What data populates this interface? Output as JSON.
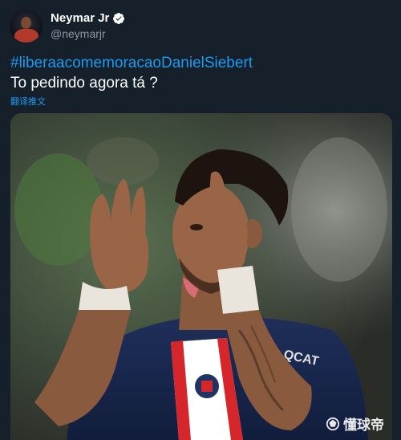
{
  "author": {
    "name": "Neymar Jr",
    "handle": "@neymarjr",
    "verified": true,
    "avatar_icon": "profile-avatar"
  },
  "tweet": {
    "hashtag": "#liberaacomemoracaoDanielSiebert",
    "text": "To pedindo agora tá ?",
    "translate_label": "翻译推文"
  },
  "media": {
    "watermark": "懂球帝",
    "watermark_icon": "dongqiudi-logo-icon"
  },
  "colors": {
    "background": "#15202b",
    "link": "#1d9bf0",
    "secondary_text": "#8b98a5",
    "verified": "#ffffff"
  }
}
